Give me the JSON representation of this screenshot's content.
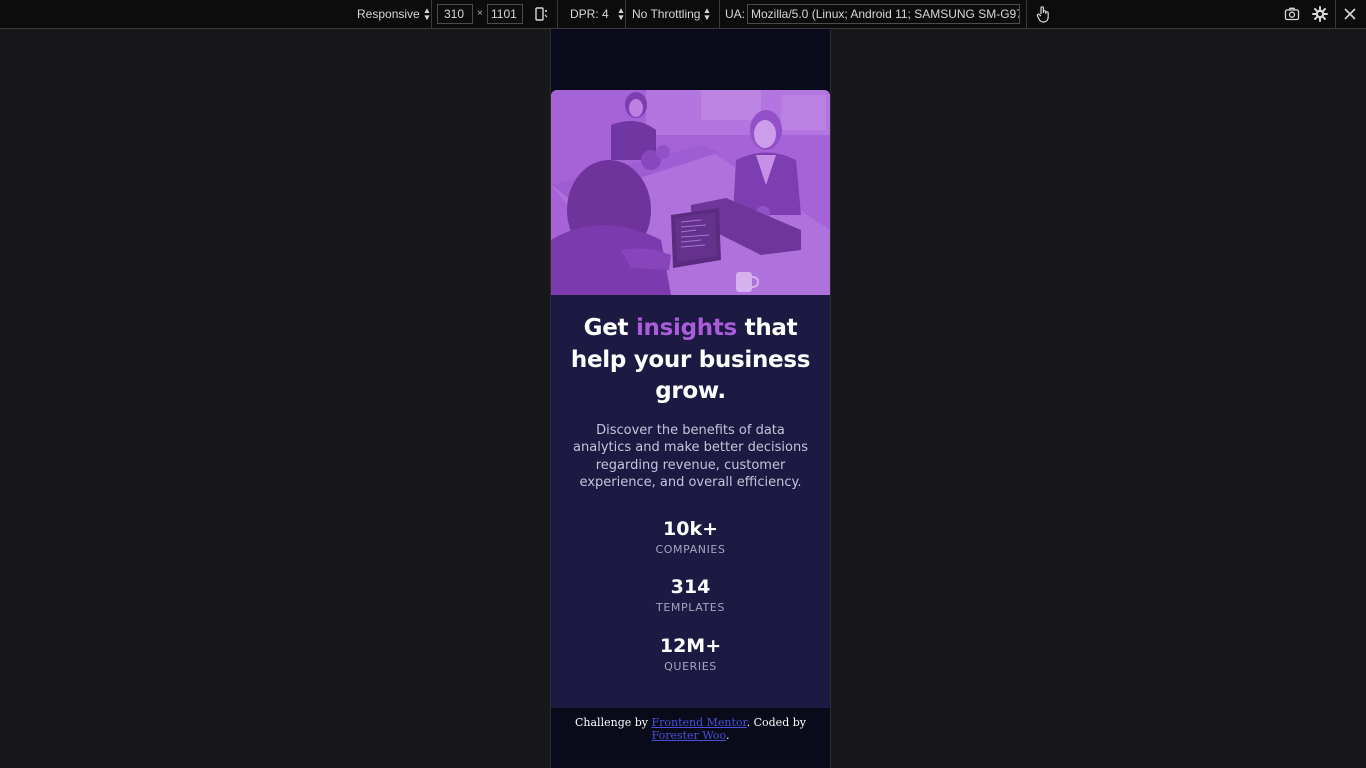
{
  "toolbar": {
    "device": "Responsive",
    "width": "310",
    "times": "×",
    "height": "1101",
    "dpr": "DPR: 4",
    "throttling": "No Throttling",
    "ua_label": "UA:",
    "ua_value": "Mozilla/5.0 (Linux; Android 11; SAMSUNG SM-G97",
    "icons": [
      "rotate-icon",
      "touch-icon",
      "screenshot-icon",
      "settings-icon",
      "close-icon"
    ]
  },
  "card": {
    "headline_pre": "Get ",
    "headline_accent": "insights",
    "headline_post": " that help your business grow.",
    "description": "Discover the benefits of data analytics and make better decisions regarding revenue, customer experience, and overall efficiency.",
    "stats": [
      {
        "value": "10k+",
        "label": "COMPANIES"
      },
      {
        "value": "314",
        "label": "TEMPLATES"
      },
      {
        "value": "12M+",
        "label": "QUERIES"
      }
    ]
  },
  "footer": {
    "text1": "Challenge by ",
    "link1": "Frontend Mentor",
    "text2": ". Coded by ",
    "link2": "Forester Woo",
    "text3": "."
  },
  "colors": {
    "page_bg": "#090b1a",
    "card_bg": "#1c1a43",
    "accent": "#aa5cdb",
    "link": "#4a4fd8"
  }
}
